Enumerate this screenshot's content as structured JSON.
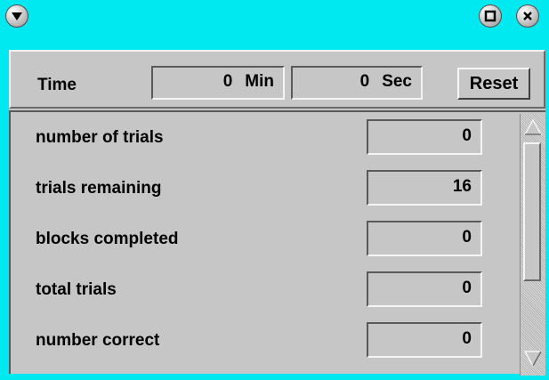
{
  "titlebar": {
    "menu_icon": "chevron-down-icon",
    "maximize_icon": "maximize-icon",
    "close_icon": "close-icon",
    "color": "#00e8f0"
  },
  "timer": {
    "label": "Time",
    "minutes_value": "0",
    "minutes_unit": "Min",
    "seconds_value": "0",
    "seconds_unit": "Sec",
    "reset_label": "Reset"
  },
  "stats": [
    {
      "label": "number of trials",
      "value": "0"
    },
    {
      "label": "trials remaining",
      "value": "16"
    },
    {
      "label": "blocks completed",
      "value": "0"
    },
    {
      "label": "total trials",
      "value": "0"
    },
    {
      "label": "number correct",
      "value": "0"
    }
  ],
  "colors": {
    "panel_background": "#c6c6c6",
    "frame_accent": "#00e8f0"
  }
}
